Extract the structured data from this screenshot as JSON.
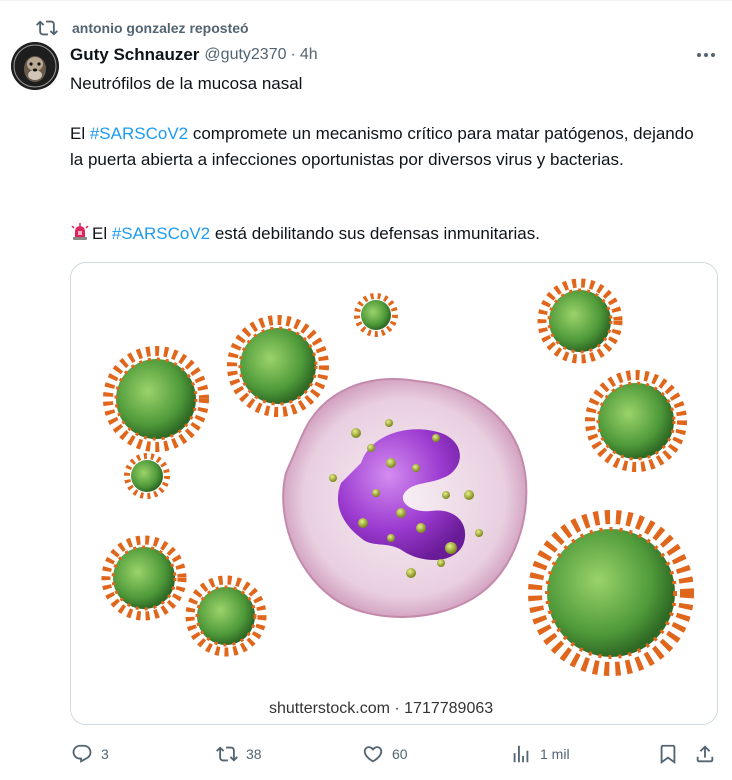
{
  "repost": {
    "icon": "repost-icon",
    "text": "antonio gonzalez reposteó"
  },
  "post": {
    "author_name": "Guty Schnauzer",
    "handle": "@guty2370",
    "separator": "·",
    "time": "4h",
    "line1": "Neutrófilos de la mucosa nasal",
    "para2_pre": "El ",
    "hashtag1": "#SARSCoV2",
    "para2_post": " compromete un mecanismo crítico para matar patógenos, dejando la puerta abierta a infecciones oportunistas por diversos virus y bacterias.",
    "alert_emoji": "police-light-emoji",
    "para3_pre": "El ",
    "hashtag2": "#SARSCoV2",
    "para3_post": " está debilitando sus defensas inmunitarias."
  },
  "media": {
    "watermark": "shutterstock.com · 1717789063",
    "description_icon": "neutrophil-virus-illustration"
  },
  "actions": {
    "replies": "3",
    "reposts": "38",
    "likes": "60",
    "views": "1 mil"
  },
  "colors": {
    "accent": "#1d9bf0",
    "muted": "#536471",
    "text": "#0f1419",
    "border": "#cfd9de"
  }
}
